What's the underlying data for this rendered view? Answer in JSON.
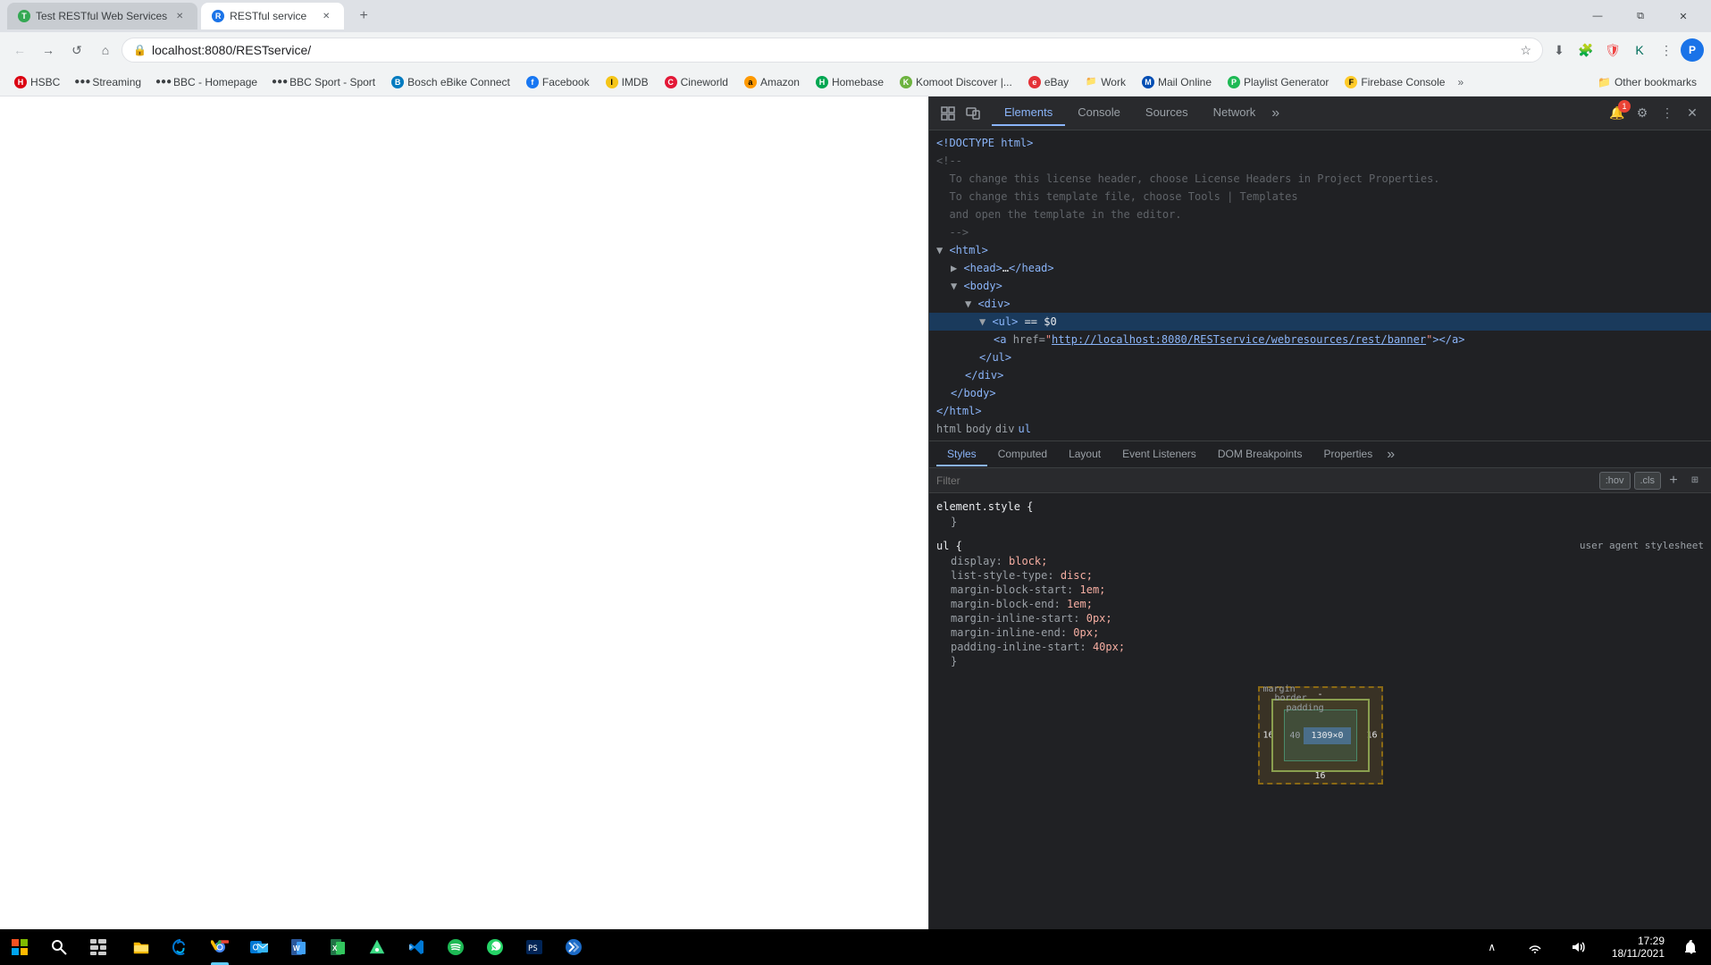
{
  "window": {
    "title": "RESTful Web Services",
    "controls": {
      "minimize": "—",
      "restore": "⧉",
      "close": "✕"
    }
  },
  "tabs": [
    {
      "id": "tab1",
      "title": "Test RESTful Web Services",
      "favicon": "T",
      "active": false,
      "favicon_color": "fav-green"
    },
    {
      "id": "tab2",
      "title": "RESTful service",
      "favicon": "R",
      "active": true,
      "favicon_color": "fav-blue"
    }
  ],
  "address_bar": {
    "url": "localhost:8080/RESTservice/"
  },
  "bookmarks": [
    {
      "id": "hsbc",
      "label": "HSBC",
      "favicon": "H",
      "color": "#db0011"
    },
    {
      "id": "streaming",
      "label": "Streaming",
      "favicon": "S",
      "color": "#555"
    },
    {
      "id": "bbc-homepage",
      "label": "BBC - Homepage",
      "favicon": "B",
      "color": "#bb1919"
    },
    {
      "id": "bbc-sport",
      "label": "BBC Sport - Sport",
      "favicon": "B",
      "color": "#bb1919"
    },
    {
      "id": "bosch",
      "label": "Bosch eBike Connect",
      "favicon": "B",
      "color": "#007bc0"
    },
    {
      "id": "facebook",
      "label": "Facebook",
      "favicon": "f",
      "color": "#1877f2"
    },
    {
      "id": "imdb",
      "label": "IMDB",
      "favicon": "I",
      "color": "#f5c518"
    },
    {
      "id": "cineworld",
      "label": "Cineworld",
      "favicon": "C",
      "color": "#e31837"
    },
    {
      "id": "amazon",
      "label": "Amazon",
      "favicon": "a",
      "color": "#ff9900"
    },
    {
      "id": "homebase",
      "label": "Homebase",
      "favicon": "H",
      "color": "#00a651"
    },
    {
      "id": "komoot",
      "label": "Komoot Discover |...",
      "favicon": "K",
      "color": "#6db33f"
    },
    {
      "id": "ebay",
      "label": "eBay",
      "favicon": "e",
      "color": "#e43137"
    },
    {
      "id": "work",
      "label": "Work",
      "favicon": "W",
      "color": "#555"
    },
    {
      "id": "mail-online",
      "label": "Mail Online",
      "favicon": "M",
      "color": "#004db3"
    },
    {
      "id": "playlist-gen",
      "label": "Playlist Generator",
      "favicon": "P",
      "color": "#1db954"
    },
    {
      "id": "firebase",
      "label": "Firebase Console",
      "favicon": "F",
      "color": "#ffca28"
    }
  ],
  "other_bookmarks_label": "Other bookmarks",
  "devtools": {
    "tabs": [
      "Elements",
      "Console",
      "Sources",
      "Network"
    ],
    "active_tab": "Elements",
    "tabs_more": "»",
    "notification_badge": "1",
    "dom_content": [
      {
        "indent": 0,
        "content": "<!DOCTYPE html>",
        "type": "doctype"
      },
      {
        "indent": 0,
        "content": "<!--",
        "type": "comment"
      },
      {
        "indent": 0,
        "content": "To change this license header, choose License Headers in Project Properties.",
        "type": "comment-text"
      },
      {
        "indent": 0,
        "content": "To change this template file, choose Tools | Templates",
        "type": "comment-text"
      },
      {
        "indent": 0,
        "content": "and open the template in the editor.",
        "type": "comment-text"
      },
      {
        "indent": 0,
        "content": "-->",
        "type": "comment"
      },
      {
        "indent": 0,
        "content": "<html>",
        "type": "tag-open"
      },
      {
        "indent": 1,
        "content": "<head>…</head>",
        "type": "tag-collapsed"
      },
      {
        "indent": 1,
        "content": "<body>",
        "type": "tag-open"
      },
      {
        "indent": 2,
        "content": "<div>",
        "type": "tag-open"
      },
      {
        "indent": 3,
        "content": "<ul> == $0",
        "type": "tag-selected"
      },
      {
        "indent": 4,
        "content": "<a href=\"http://localhost:8080/RESTservice/webresources/rest/banner\"></a>",
        "type": "tag-link"
      },
      {
        "indent": 3,
        "content": "</ul>",
        "type": "tag-close"
      },
      {
        "indent": 2,
        "content": "</div>",
        "type": "tag-close"
      },
      {
        "indent": 1,
        "content": "</body>",
        "type": "tag-close"
      },
      {
        "indent": 0,
        "content": "</html>",
        "type": "tag-close"
      }
    ],
    "breadcrumb": [
      "html",
      "body",
      "div",
      "ul"
    ],
    "styles_tabs": [
      "Styles",
      "Computed",
      "Layout",
      "Event Listeners",
      "DOM Breakpoints",
      "Properties"
    ],
    "active_styles_tab": "Styles",
    "filter_placeholder": "Filter",
    "filter_hov": ":hov",
    "filter_cls": ".cls",
    "style_rules": [
      {
        "selector": "element.style {",
        "source": "",
        "properties": [],
        "close": "}"
      },
      {
        "selector": "ul {",
        "source": "user agent stylesheet",
        "properties": [
          {
            "name": "display",
            "value": "block;"
          },
          {
            "name": "list-style-type",
            "value": "disc;"
          },
          {
            "name": "margin-block-start",
            "value": "1em;"
          },
          {
            "name": "margin-block-end",
            "value": "1em;"
          },
          {
            "name": "margin-inline-start",
            "value": "0px;"
          },
          {
            "name": "margin-inline-end",
            "value": "0px;"
          },
          {
            "name": "padding-inline-start",
            "value": "40px;"
          }
        ],
        "close": "}"
      }
    ],
    "box_model": {
      "margin_label": "margin",
      "margin_top": "-",
      "margin_bottom": "-",
      "margin_left": "16",
      "margin_right": "16",
      "border_label": "border",
      "border_value": "-",
      "padding_label": "padding",
      "padding_value": "-",
      "content": "1309×0",
      "content_left": "40",
      "size_bottom": "16"
    }
  },
  "taskbar": {
    "time": "17:29",
    "date": "18/11/2021",
    "apps": [
      {
        "id": "start",
        "label": "Start",
        "icon": "⊞"
      },
      {
        "id": "search",
        "label": "Search",
        "icon": "🔍"
      },
      {
        "id": "taskview",
        "label": "Task View",
        "icon": "⧉"
      },
      {
        "id": "explorer",
        "label": "File Explorer",
        "icon": "📁"
      },
      {
        "id": "edge",
        "label": "Edge",
        "icon": "⬡"
      },
      {
        "id": "chrome",
        "label": "Chrome",
        "icon": "●"
      },
      {
        "id": "word",
        "label": "Word",
        "icon": "W"
      },
      {
        "id": "excel",
        "label": "Excel",
        "icon": "X"
      },
      {
        "id": "android-studio",
        "label": "Android Studio",
        "icon": "▲"
      },
      {
        "id": "vscode",
        "label": "VS Code",
        "icon": "≺≻"
      },
      {
        "id": "spotify",
        "label": "Spotify",
        "icon": "♫"
      },
      {
        "id": "whatsapp",
        "label": "WhatsApp",
        "icon": "💬"
      },
      {
        "id": "terminal",
        "label": "Terminal",
        "icon": ">_"
      },
      {
        "id": "netbeans",
        "label": "NetBeans",
        "icon": "NB"
      }
    ]
  }
}
